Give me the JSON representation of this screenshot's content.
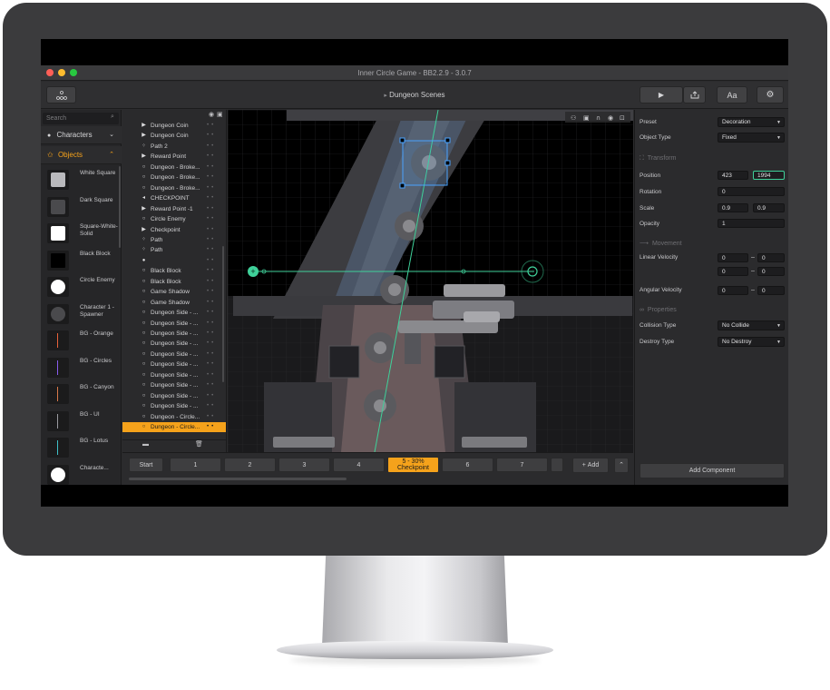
{
  "window": {
    "title": "Inner Circle Game - BB2.2.9 - 3.0.7"
  },
  "toolbar": {
    "scene_title": "Dungeon Scenes",
    "text_button": "Aa"
  },
  "left_panel": {
    "search_placeholder": "Search",
    "categories": {
      "characters": "Characters",
      "objects": "Objects"
    },
    "objects": [
      {
        "label": "White Square",
        "thumb": "white-square"
      },
      {
        "label": "Dark Square",
        "thumb": "dark-square"
      },
      {
        "label": "Square-White-Solid",
        "thumb": "white-solid"
      },
      {
        "label": "Black Block",
        "thumb": "black-block"
      },
      {
        "label": "Circle Enemy",
        "thumb": "white-circle"
      },
      {
        "label": "Character 1 - Spawner",
        "thumb": "dark-circle"
      },
      {
        "label": "BG - Orange",
        "thumb": "line",
        "color": "#e8623a"
      },
      {
        "label": "BG - Circles",
        "thumb": "line",
        "color": "#8a5cf0"
      },
      {
        "label": "BG - Canyon",
        "thumb": "line",
        "color": "#d9794a"
      },
      {
        "label": "BG - UI",
        "thumb": "line",
        "color": "#9a9aa0"
      },
      {
        "label": "BG - Lotus",
        "thumb": "line",
        "color": "#3fc1c9"
      },
      {
        "label": "Characte...",
        "thumb": "white-circle"
      }
    ]
  },
  "hierarchy": {
    "items": [
      {
        "label": "Dungeon Coin",
        "icon": "play"
      },
      {
        "label": "Dungeon Coin",
        "icon": "play"
      },
      {
        "label": "Path 2",
        "icon": "path"
      },
      {
        "label": "Reward Point",
        "icon": "play"
      },
      {
        "label": "Dungeon - Broke...",
        "icon": "circle"
      },
      {
        "label": "Dungeon - Broke...",
        "icon": "circle"
      },
      {
        "label": "Dungeon - Broke...",
        "icon": "circle"
      },
      {
        "label": "CHECKPOINT",
        "icon": "flag"
      },
      {
        "label": "Reward Point -1",
        "icon": "play"
      },
      {
        "label": "Circle Enemy",
        "icon": "circle"
      },
      {
        "label": "Checkpoint",
        "icon": "play"
      },
      {
        "label": "Path",
        "icon": "path"
      },
      {
        "label": "Path",
        "icon": "path"
      },
      {
        "label": "",
        "icon": "person"
      },
      {
        "label": "Black Block",
        "icon": "circle"
      },
      {
        "label": "Black Block",
        "icon": "circle"
      },
      {
        "label": "Game Shadow",
        "icon": "circle"
      },
      {
        "label": "Game Shadow",
        "icon": "circle"
      },
      {
        "label": "Dungeon Side - ...",
        "icon": "circle"
      },
      {
        "label": "Dungeon Side - ...",
        "icon": "circle"
      },
      {
        "label": "Dungeon Side - ...",
        "icon": "circle"
      },
      {
        "label": "Dungeon Side - ...",
        "icon": "circle"
      },
      {
        "label": "Dungeon Side - ...",
        "icon": "circle"
      },
      {
        "label": "Dungeon Side - ...",
        "icon": "circle"
      },
      {
        "label": "Dungeon Side - ...",
        "icon": "circle"
      },
      {
        "label": "Dungeon Side - ...",
        "icon": "circle"
      },
      {
        "label": "Dungeon Side - ...",
        "icon": "circle"
      },
      {
        "label": "Dungeon Side - ...",
        "icon": "circle"
      },
      {
        "label": "Dungeon - Circle...",
        "icon": "circle"
      },
      {
        "label": "Dungeon - Circle...",
        "icon": "circle",
        "selected": true
      }
    ]
  },
  "timeline": {
    "checkpoints": [
      "Start",
      "1",
      "2",
      "3",
      "4",
      "5 - 30%\nCheckpoint",
      "6",
      "7"
    ],
    "active_index": 5,
    "add_label": "Add"
  },
  "inspector": {
    "preset_label": "Preset",
    "preset_value": "Decoration",
    "object_type_label": "Object Type",
    "object_type_value": "Fixed",
    "transform_title": "Transform",
    "position_label": "Position",
    "position_x": "423",
    "position_y": "1994",
    "rotation_label": "Rotation",
    "rotation_value": "0",
    "scale_label": "Scale",
    "scale_x": "0.9",
    "scale_y": "0.9",
    "opacity_label": "Opacity",
    "opacity_value": "1",
    "movement_title": "Movement",
    "linear_velocity_label": "Linear Velocity",
    "lv_x_min": "0",
    "lv_x_max": "0",
    "lv_y_min": "0",
    "lv_y_max": "0",
    "angular_velocity_label": "Angular Velocity",
    "av_min": "0",
    "av_max": "0",
    "properties_title": "Properties",
    "collision_label": "Collision Type",
    "collision_value": "No Collide",
    "destroy_label": "Destroy Type",
    "destroy_value": "No Destroy",
    "add_component_label": "Add Component"
  },
  "colors": {
    "accent": "#f5a21b",
    "path_line": "#3fd19a",
    "selection": "#4aa3ff",
    "traffic_red": "#fd5f57",
    "traffic_yellow": "#febc2e",
    "traffic_green": "#28c840"
  }
}
